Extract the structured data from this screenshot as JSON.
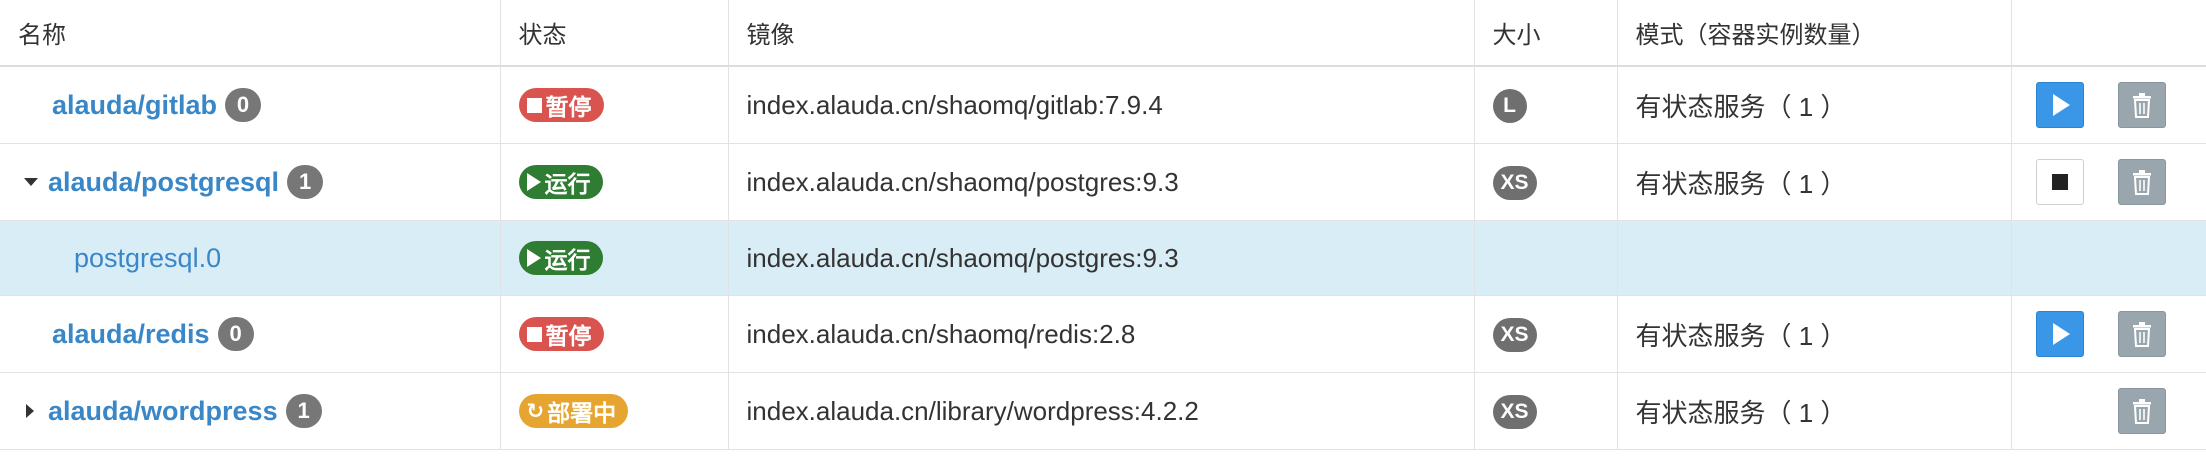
{
  "headers": {
    "name": "名称",
    "status": "状态",
    "image": "镜像",
    "size": "大小",
    "mode": "模式（容器实例数量）"
  },
  "rows": [
    {
      "name": "alauda/gitlab",
      "count": "0",
      "status": "暂停",
      "status_kind": "paused",
      "image": "index.alauda.cn/shaomq/gitlab:7.9.4",
      "size": "L",
      "mode": "有状态服务（ 1 ）"
    },
    {
      "name": "alauda/postgresql",
      "count": "1",
      "status": "运行",
      "status_kind": "running",
      "image": "index.alauda.cn/shaomq/postgres:9.3",
      "size": "XS",
      "mode": "有状态服务（ 1 ）"
    },
    {
      "name": "postgresql.0",
      "status": "运行",
      "status_kind": "running",
      "image": "index.alauda.cn/shaomq/postgres:9.3"
    },
    {
      "name": "alauda/redis",
      "count": "0",
      "status": "暂停",
      "status_kind": "paused",
      "image": "index.alauda.cn/shaomq/redis:2.8",
      "size": "XS",
      "mode": "有状态服务（ 1 ）"
    },
    {
      "name": "alauda/wordpress",
      "count": "1",
      "status": "部署中",
      "status_kind": "deploying",
      "image": "index.alauda.cn/library/wordpress:4.2.2",
      "size": "XS",
      "mode": "有状态服务（ 1 ）"
    }
  ],
  "colors": {
    "link": "#3a87c8",
    "paused": "#d9534f",
    "running": "#2e7d32",
    "deploying": "#e6a530",
    "start_button": "#3a97e8",
    "delete_button": "#9aa6ad",
    "child_row_bg": "#d9edf7"
  },
  "icons": {
    "paused": "square-icon",
    "running": "play-icon",
    "deploying": "refresh-icon",
    "start": "play-icon",
    "stop": "stop-icon",
    "delete": "trash-icon"
  }
}
